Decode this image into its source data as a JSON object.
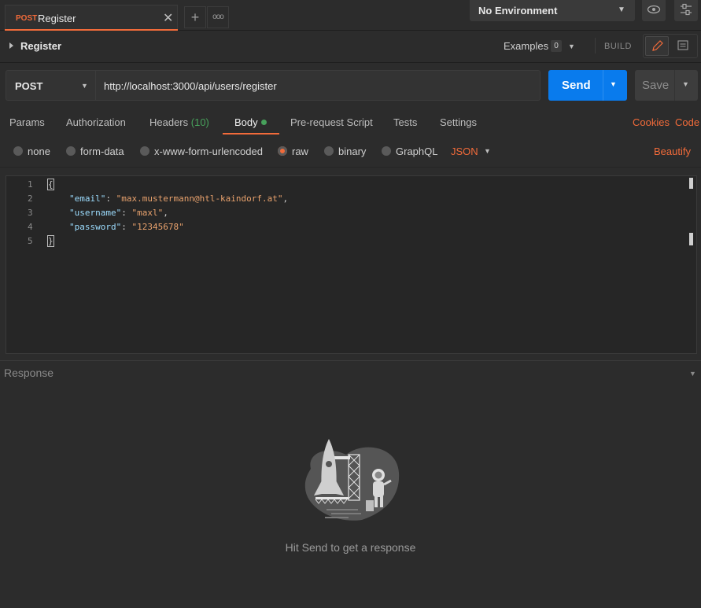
{
  "tabs": [
    {
      "method": "POST",
      "name": "Register"
    }
  ],
  "tab_actions": {
    "new_tab": "+",
    "more": "ooo"
  },
  "environment": {
    "selected": "No Environment"
  },
  "request": {
    "title": "Register",
    "examples_label": "Examples",
    "examples_count": "0",
    "build_label": "BUILD",
    "method": "POST",
    "url": "http://localhost:3000/api/users/register",
    "send_label": "Send",
    "save_label": "Save"
  },
  "request_tabs": {
    "params": "Params",
    "authorization": "Authorization",
    "headers": "Headers",
    "headers_count": "(10)",
    "body": "Body",
    "pre_request": "Pre-request Script",
    "tests": "Tests",
    "settings": "Settings",
    "cookies": "Cookies",
    "code": "Code"
  },
  "body_types": {
    "none": "none",
    "form_data": "form-data",
    "urlencoded": "x-www-form-urlencoded",
    "raw": "raw",
    "binary": "binary",
    "graphql": "GraphQL",
    "selected": "raw",
    "format": "JSON",
    "beautify": "Beautify"
  },
  "editor": {
    "line_numbers": [
      "1",
      "2",
      "3",
      "4",
      "5"
    ],
    "open_brace": "{",
    "close_brace": "}",
    "fields": [
      {
        "key": "\"email\"",
        "value": "\"max.mustermann@htl-kaindorf.at\"",
        "comma": ","
      },
      {
        "key": "\"username\"",
        "value": "\"maxl\"",
        "comma": ","
      },
      {
        "key": "\"password\"",
        "value": "\"12345678\"",
        "comma": ""
      }
    ]
  },
  "response": {
    "title": "Response",
    "empty_hint": "Hit Send to get a response"
  },
  "colors": {
    "accent": "#f26b3a",
    "send_blue": "#097bed",
    "status_green": "#47a15b"
  }
}
